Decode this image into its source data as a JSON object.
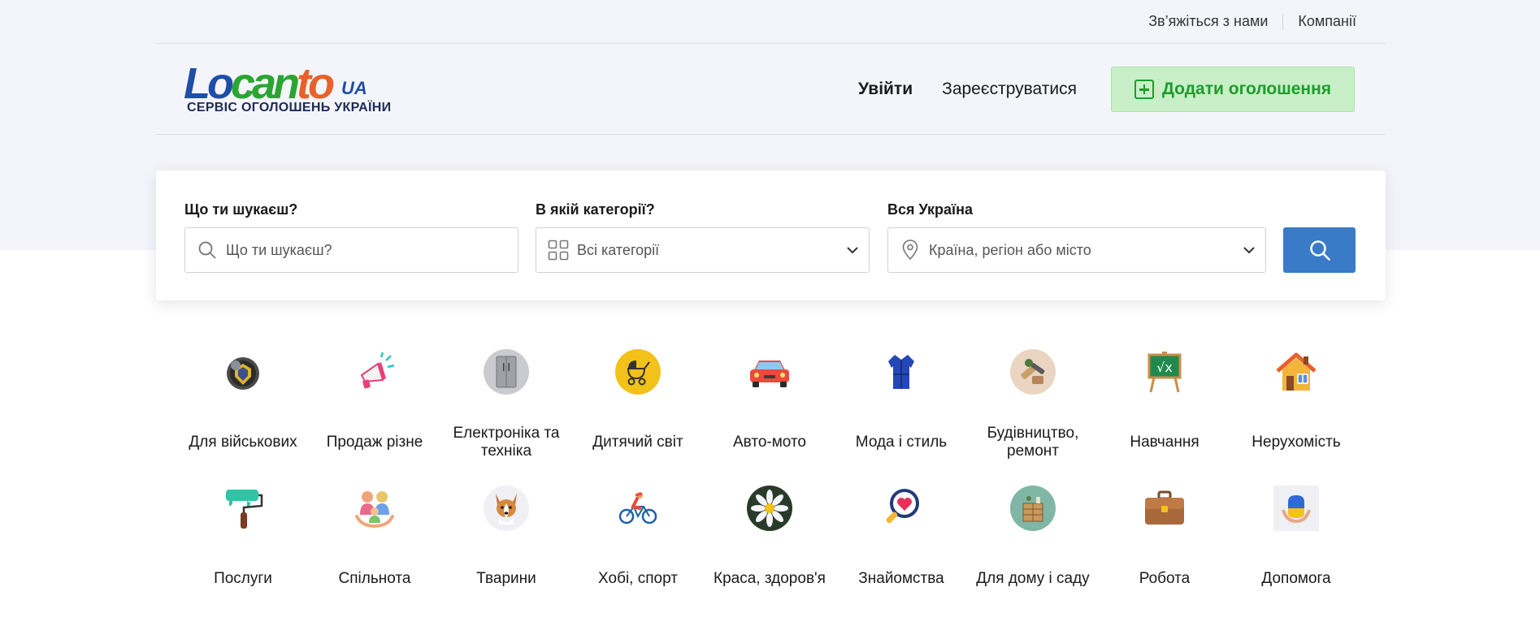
{
  "topbar": {
    "contact": "Зв’яжіться з нами",
    "companies": "Компанії"
  },
  "logo": {
    "word_part1": "Lo",
    "word_part2": "can",
    "word_part3": "to",
    "country": "UA",
    "tagline": "СЕРВІС ОГОЛОШЕНЬ УКРАЇНИ"
  },
  "nav": {
    "login": "Увійти",
    "register": "Зареєструватися",
    "add_ad": "Додати оголошення"
  },
  "search": {
    "what_label": "Що ти шукаєш?",
    "what_placeholder": "Що ти шукаєш?",
    "category_label": "В якій категорії?",
    "category_value": "Всі категорії",
    "location_label": "Вся Україна",
    "location_placeholder": "Країна, регіон або місто"
  },
  "categories": [
    {
      "label": "Для військових",
      "icon": "military-badge-icon"
    },
    {
      "label": "Продаж різне",
      "icon": "megaphone-icon"
    },
    {
      "label": "Електроніка та техніка",
      "icon": "fridge-icon"
    },
    {
      "label": "Дитячий світ",
      "icon": "stroller-icon"
    },
    {
      "label": "Авто-мото",
      "icon": "car-icon"
    },
    {
      "label": "Мода і стиль",
      "icon": "robe-icon"
    },
    {
      "label": "Будівництво, ремонт",
      "icon": "repair-tools-icon"
    },
    {
      "label": "Навчання",
      "icon": "chalkboard-icon"
    },
    {
      "label": "Нерухомість",
      "icon": "house-icon"
    },
    {
      "label": "Послуги",
      "icon": "paint-roller-icon"
    },
    {
      "label": "Спільнота",
      "icon": "family-icon"
    },
    {
      "label": "Тварини",
      "icon": "dog-icon"
    },
    {
      "label": "Хобі, спорт",
      "icon": "cyclist-icon"
    },
    {
      "label": "Краса, здоров'я",
      "icon": "flower-icon"
    },
    {
      "label": "Знайомства",
      "icon": "magnifier-heart-icon"
    },
    {
      "label": "Для дому і саду",
      "icon": "dresser-icon"
    },
    {
      "label": "Робота",
      "icon": "briefcase-icon"
    },
    {
      "label": "Допомога",
      "icon": "helping-hands-icon"
    }
  ],
  "colors": {
    "brand_blue": "#1f4ea8",
    "brand_green": "#2aa532",
    "brand_orange": "#e8612a",
    "add_button_bg": "#c8efc7",
    "add_button_text": "#1e9c2c",
    "search_button": "#3a7bc7"
  }
}
